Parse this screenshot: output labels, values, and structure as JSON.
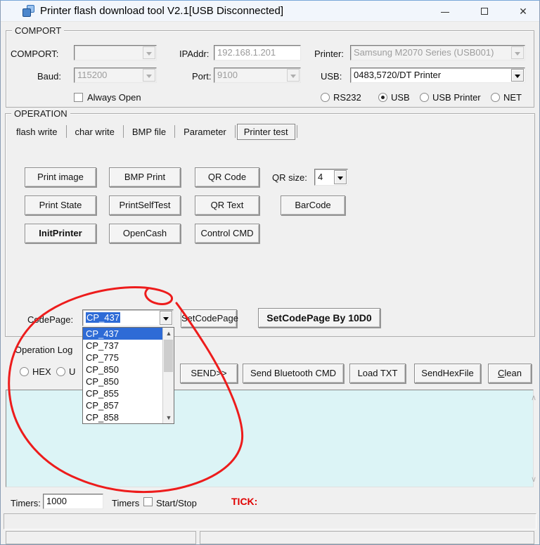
{
  "window": {
    "title": "Printer flash download tool V2.1[USB Disconnected]"
  },
  "comport": {
    "legend": "COMPORT",
    "comport_label": "COMPORT:",
    "comport_value": "",
    "ipaddr_label": "IPAddr:",
    "ipaddr_value": "192.168.1.201",
    "printer_label": "Printer:",
    "printer_value": "Samsung M2070 Series (USB001)",
    "baud_label": "Baud:",
    "baud_value": "115200",
    "port_label": "Port:",
    "port_value": "9100",
    "usb_label": "USB:",
    "usb_value": "0483,5720/DT Printer",
    "always_open_label": "Always Open",
    "radios": [
      {
        "label": "RS232",
        "selected": false
      },
      {
        "label": "USB",
        "selected": true
      },
      {
        "label": "USB Printer",
        "selected": false
      },
      {
        "label": "NET",
        "selected": false
      }
    ]
  },
  "operation": {
    "legend": "OPERATION",
    "tabs": [
      {
        "label": "flash write",
        "active": false
      },
      {
        "label": "char write",
        "active": false
      },
      {
        "label": "BMP file",
        "active": false
      },
      {
        "label": "Parameter",
        "active": false
      },
      {
        "label": "Printer test",
        "active": true
      }
    ],
    "buttons": {
      "print_image": "Print image",
      "bmp_print": "BMP Print",
      "qr_code": "QR Code",
      "print_state": "Print State",
      "print_self_test": "PrintSelfTest",
      "qr_text": "QR Text",
      "barcode": "BarCode",
      "init_printer": "InitPrinter",
      "open_cash": "OpenCash",
      "control_cmd": "Control CMD"
    },
    "qr_size_label": "QR size:",
    "qr_size_value": "4",
    "codepage_label": "CodePage:",
    "codepage_value": "CP_437",
    "set_codepage": "SetCodePage",
    "set_codepage_by_10d0": "SetCodePage By 10D0"
  },
  "codepage_dropdown": {
    "selected_index": 0,
    "items": [
      "CP_437",
      "CP_737",
      "CP_775",
      "CP_850",
      "CP_850",
      "CP_855",
      "CP_857",
      "CP_858"
    ]
  },
  "log": {
    "title": "Operation Log",
    "hex_label": "HEX",
    "second_radio_label": "U",
    "send": "SEND>>",
    "send_bluetooth": "Send Bluetooth CMD",
    "load_txt": "Load TXT",
    "send_hex_file": "SendHexFile",
    "clean": "Clean",
    "content": ""
  },
  "timers": {
    "label": "Timers:",
    "value": "1000",
    "checkbox_label": "Timers",
    "startstop_label": "Start/Stop",
    "tick_label": "TICK:"
  },
  "statusbar": {
    "panel1": "",
    "panel2": ""
  },
  "colors": {
    "selection_blue": "#2e6bd6",
    "log_background": "#dcf4f6",
    "annotation_red": "#ed1c1c",
    "tick_red": "#e00000"
  }
}
